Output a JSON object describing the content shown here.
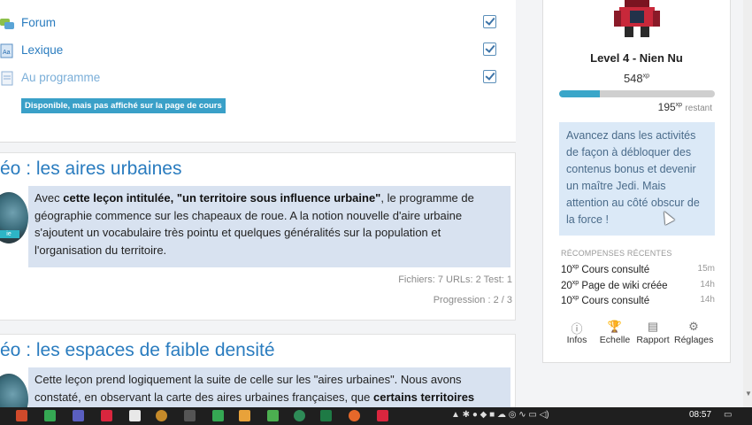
{
  "activities": [
    {
      "label": "Forum",
      "icon": "forum-icon",
      "checked": true
    },
    {
      "label": "Lexique",
      "icon": "glossary-icon",
      "checked": true
    },
    {
      "label": "Au programme",
      "icon": "page-icon",
      "checked": true
    }
  ],
  "availability_badge": "Disponible, mais pas affiché sur la page de cours",
  "lessons": [
    {
      "title": "éo : les aires urbaines",
      "avatar_tag": "ie",
      "summary_parts": [
        "Avec ",
        "cette leçon intitulée, \"un territoire sous influence urbaine\"",
        ", le programme de géographie commence sur les chapeaux de roue. A la notion nouvelle d'aire urbaine s'ajoutent un vocabulaire très pointu et quelques généralités sur la population et l'organisation du territoire."
      ],
      "stats": "Fichiers: 7  URLs: 2  Test: 1",
      "progress": "Progression : 2 / 3"
    },
    {
      "title": "éo : les espaces de faible densité",
      "summary_parts": [
        "Cette leçon prend logiquement la suite de celle sur les \"aires urbaines\". Nous avons constaté, en observant la carte des aires urbaines françaises, que ",
        "certains territoires semblaient \"à l'écart\"",
        "."
      ]
    }
  ],
  "level": {
    "title": "Level 4 - Nien Nu",
    "xp_value": "548",
    "xp_unit": "xp",
    "progress_fraction": 0.26,
    "remaining_value": "195",
    "remaining_unit": "xp",
    "remaining_label": "restant",
    "bar_color": "#3aa6c9"
  },
  "info_text": "Avancez dans les activités de façon à débloquer des contenus bonus et devenir un maître Jedi. Mais attention au côté obscur de la force !",
  "rewards": {
    "title": "RÉCOMPENSES RÉCENTES",
    "items": [
      {
        "points": "10",
        "unit": "xp",
        "label": "Cours consulté",
        "time": "15m"
      },
      {
        "points": "20",
        "unit": "xp",
        "label": "Page de wiki créée",
        "time": "14h"
      },
      {
        "points": "10",
        "unit": "xp",
        "label": "Cours consulté",
        "time": "14h"
      }
    ]
  },
  "tools": [
    {
      "label": "Infos",
      "icon": "info-icon",
      "glyph": "ⓘ"
    },
    {
      "label": "Echelle",
      "icon": "trophy-icon",
      "glyph": "🏆"
    },
    {
      "label": "Rapport",
      "icon": "report-icon",
      "glyph": "▤"
    },
    {
      "label": "Réglages",
      "icon": "gear-icon",
      "glyph": "⚙"
    }
  ],
  "taskbar": {
    "clock": "08:57"
  }
}
